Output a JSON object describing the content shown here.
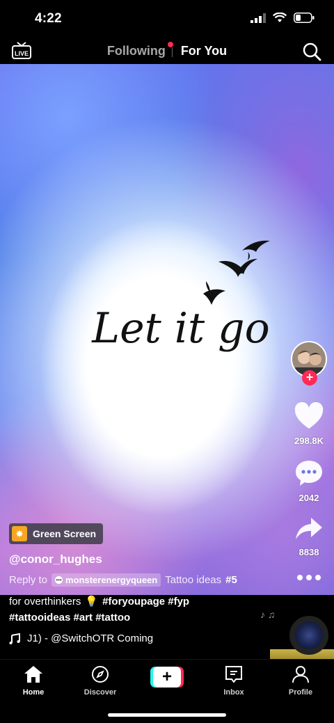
{
  "status_bar": {
    "time": "4:22"
  },
  "top_nav": {
    "live_label": "LIVE",
    "tabs": [
      {
        "label": "Following",
        "active": false,
        "has_dot": true
      },
      {
        "label": "For You",
        "active": true
      }
    ]
  },
  "video": {
    "overlay_text": "Let it go"
  },
  "creator": {
    "username": "@conor_hughes"
  },
  "actions": {
    "likes": "298.8K",
    "comments": "2042",
    "shares": "8838"
  },
  "effect": {
    "label": "Green Screen"
  },
  "reply": {
    "prefix": "Reply to",
    "mention": "monsterenergyqueen",
    "text": "Tattoo ideas",
    "tag": "#5"
  },
  "caption": {
    "line1_text": "for overthinkers",
    "line1_emoji": "💡",
    "line1_tags": "#foryoupage #fyp",
    "line2_tags": "#tattooideas #art #tattoo"
  },
  "music": {
    "text": "J1) - @SwitchOTR    Coming"
  },
  "bottom_tabs": {
    "home": "Home",
    "discover": "Discover",
    "inbox": "Inbox",
    "profile": "Profile"
  },
  "colors": {
    "accent": "#fe2c55",
    "cyan": "#25f4ee",
    "background": "#000000"
  }
}
